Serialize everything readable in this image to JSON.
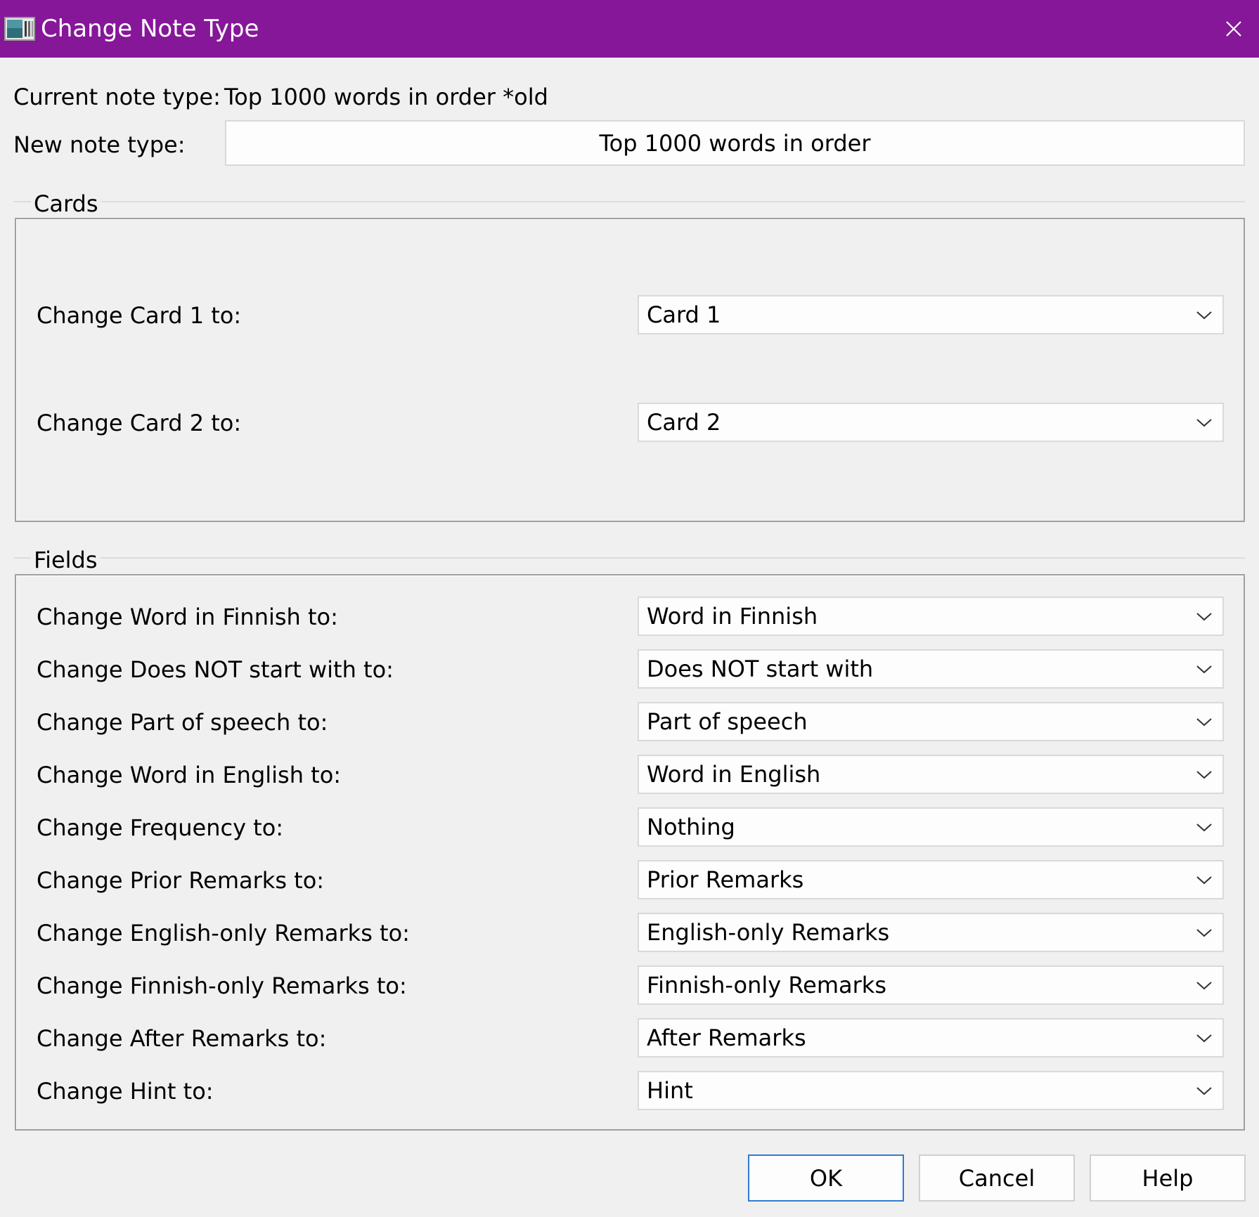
{
  "window": {
    "title": "Change Note Type",
    "title_bar_color": "#861799",
    "app_icon": "anki-app-icon",
    "close_icon": "close-icon"
  },
  "header": {
    "current_label": "Current note type:",
    "current_value": "Top 1000 words in order *old",
    "new_label": "New note type:",
    "new_value": "Top 1000 words in order"
  },
  "cards": {
    "title": "Cards",
    "rows": [
      {
        "label": "Change Card 1 to:",
        "value": "Card 1"
      },
      {
        "label": "Change Card 2 to:",
        "value": "Card 2"
      }
    ]
  },
  "fields": {
    "title": "Fields",
    "rows": [
      {
        "label": "Change Word in Finnish to:",
        "value": "Word in Finnish"
      },
      {
        "label": "Change Does NOT start with to:",
        "value": "Does NOT start with"
      },
      {
        "label": "Change Part of speech to:",
        "value": "Part of speech"
      },
      {
        "label": "Change Word in English to:",
        "value": "Word in English"
      },
      {
        "label": "Change Frequency to:",
        "value": "Nothing"
      },
      {
        "label": "Change Prior Remarks to:",
        "value": "Prior Remarks"
      },
      {
        "label": "Change English-only Remarks to:",
        "value": "English-only Remarks"
      },
      {
        "label": "Change Finnish-only Remarks to:",
        "value": "Finnish-only Remarks"
      },
      {
        "label": "Change After Remarks to:",
        "value": "After Remarks"
      },
      {
        "label": "Change Hint to:",
        "value": "Hint"
      }
    ]
  },
  "buttons": {
    "ok": "OK",
    "cancel": "Cancel",
    "help": "Help",
    "default_border_color": "#2f7bd1"
  }
}
